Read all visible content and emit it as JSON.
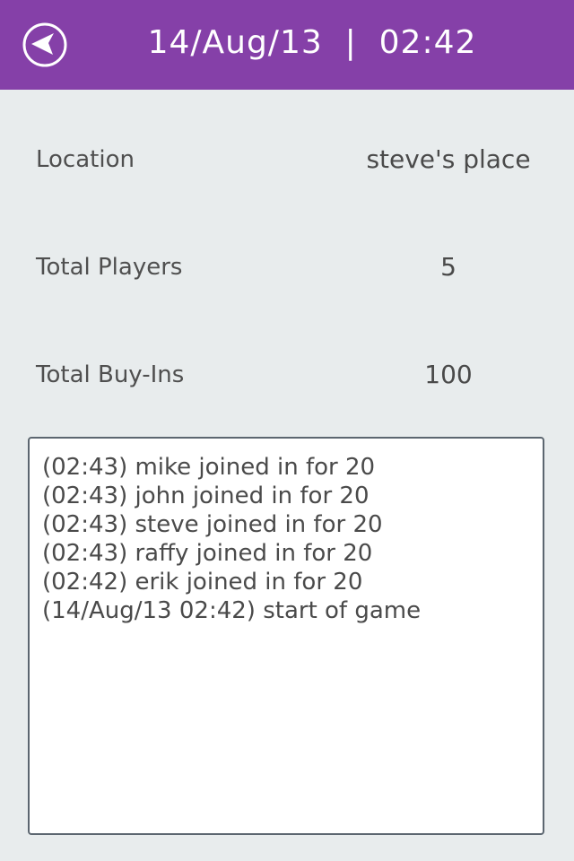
{
  "header": {
    "title": "14/Aug/13  |  02:42",
    "back_icon": "back-arrow-circle-icon"
  },
  "details": {
    "location": {
      "label": "Location",
      "value": "steve's place"
    },
    "total_players": {
      "label": "Total Players",
      "value": "5"
    },
    "total_buyins": {
      "label": "Total Buy-Ins",
      "value": "100"
    }
  },
  "log": {
    "lines": [
      "(02:43) mike joined in for 20",
      "(02:43) john joined in for 20",
      "(02:43) steve joined in for 20",
      "(02:43) raffy joined in for 20",
      "(02:42) erik joined in for 20",
      "(14/Aug/13 02:42) start of game"
    ]
  },
  "colors": {
    "header_bg": "#8540a8",
    "page_bg": "#e8eced",
    "text": "#4a4a4a"
  }
}
